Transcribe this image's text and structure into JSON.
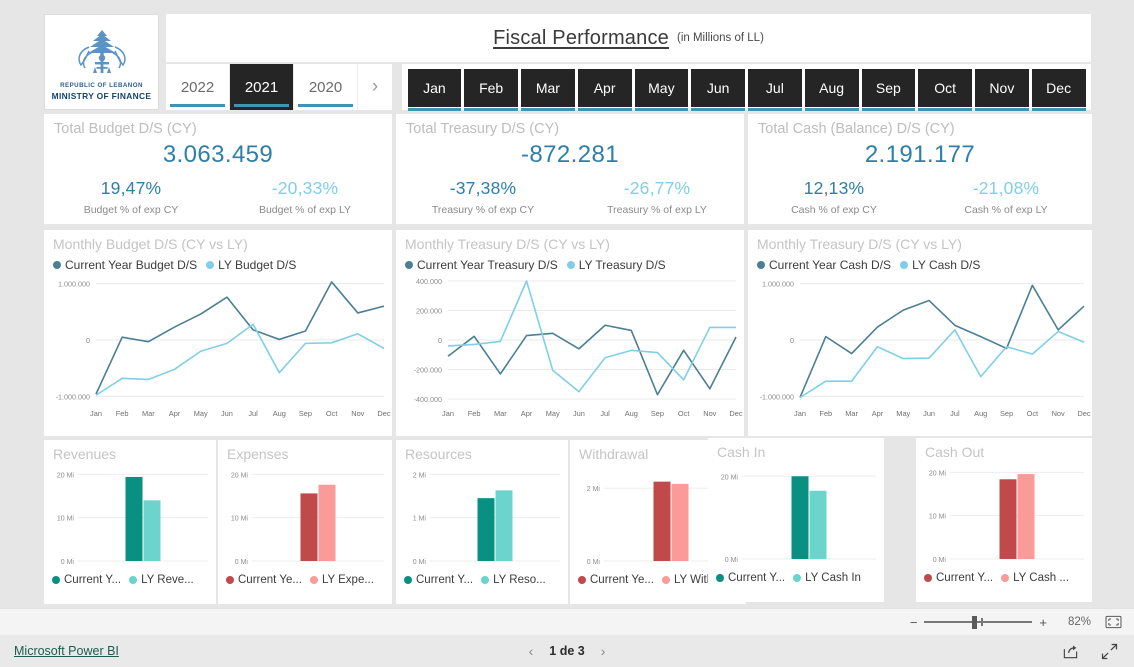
{
  "logo": {
    "icon": "lebanon-cedar-emblem-icon",
    "line1": "REPUBLIC OF LEBANON",
    "line2": "MINISTRY OF FINANCE"
  },
  "header": {
    "title": "Fiscal Performance",
    "subtitle": "(in Millions of LL)"
  },
  "year_slicer": {
    "items": [
      {
        "label": "2022",
        "selected": false
      },
      {
        "label": "2021",
        "selected": true
      },
      {
        "label": "2020",
        "selected": false
      }
    ],
    "next_icon": "chevron-right-icon"
  },
  "month_slicer": {
    "items": [
      "Jan",
      "Feb",
      "Mar",
      "Apr",
      "May",
      "Jun",
      "Jul",
      "Aug",
      "Sep",
      "Oct",
      "Nov",
      "Dec"
    ]
  },
  "kpis": [
    {
      "title": "Total Budget D/S (CY)",
      "value": "3.063.459",
      "cy_pct": "19,47%",
      "cy_label": "Budget % of exp CY",
      "ly_pct": "-20,33%",
      "ly_label": "Budget % of exp LY"
    },
    {
      "title": "Total Treasury D/S (CY)",
      "value": "-872.281",
      "cy_pct": "-37,38%",
      "cy_label": "Treasury % of exp CY",
      "ly_pct": "-26,77%",
      "ly_label": "Treasury % of exp LY"
    },
    {
      "title": "Total Cash (Balance) D/S (CY)",
      "value": "2.191.177",
      "cy_pct": "12,13%",
      "cy_label": "Cash % of exp CY",
      "ly_pct": "-21,08%",
      "ly_label": "Cash % of exp LY"
    }
  ],
  "colors": {
    "cy_line": "#4a7f94",
    "ly_line": "#7fcfe8",
    "cy_bar_teal": "#0a8f83",
    "ly_bar_teal": "#6bd4cc",
    "cy_bar_red": "#c0494a",
    "ly_bar_red": "#fa9a99",
    "value_blue": "#2e7fa8",
    "accent_underline": "#3f93b5",
    "selected_bg": "#252525"
  },
  "chart_data": [
    {
      "type": "line",
      "title": "Monthly Budget D/S (CY vs LY)",
      "xlabel": "",
      "ylabel": "",
      "categories": [
        "Jan",
        "Feb",
        "Mar",
        "Apr",
        "May",
        "Jun",
        "Jul",
        "Aug",
        "Sep",
        "Oct",
        "Nov",
        "Dec"
      ],
      "yticks": [
        -1000000,
        0,
        1000000
      ],
      "ytick_labels": [
        "-1.000.000",
        "0",
        "1.000.000"
      ],
      "ylim": [
        -1100000,
        1100000
      ],
      "grid": true,
      "legend_position": "top-left",
      "series": [
        {
          "name": "Current Year Budget D/S",
          "color": "#4a7f94",
          "values": [
            -960000,
            50000,
            -30000,
            230000,
            460000,
            760000,
            180000,
            10000,
            160000,
            1030000,
            480000,
            600000
          ]
        },
        {
          "name": "LY Budget D/S",
          "color": "#7fcfe8",
          "values": [
            -980000,
            -680000,
            -700000,
            -520000,
            -200000,
            -60000,
            280000,
            -580000,
            -60000,
            -50000,
            110000,
            -150000
          ]
        }
      ]
    },
    {
      "type": "line",
      "title": "Monthly Treasury D/S (CY vs LY)",
      "xlabel": "",
      "ylabel": "",
      "categories": [
        "Jan",
        "Feb",
        "Mar",
        "Apr",
        "May",
        "Jun",
        "Jul",
        "Aug",
        "Sep",
        "Oct",
        "Nov",
        "Dec"
      ],
      "yticks": [
        -400000,
        -200000,
        0,
        200000,
        400000
      ],
      "ytick_labels": [
        "-400.000",
        "-200.000",
        "0",
        "200.000",
        "400.000"
      ],
      "ylim": [
        -420000,
        420000
      ],
      "grid": true,
      "legend_position": "top-left",
      "series": [
        {
          "name": "Current Year Treasury D/S",
          "color": "#4a7f94",
          "values": [
            -110000,
            25000,
            -230000,
            30000,
            45000,
            -60000,
            100000,
            65000,
            -370000,
            -70000,
            -330000,
            20000
          ]
        },
        {
          "name": "LY Treasury D/S",
          "color": "#7fcfe8",
          "values": [
            -40000,
            -30000,
            -10000,
            400000,
            -205000,
            -350000,
            -120000,
            -70000,
            -85000,
            -270000,
            85000,
            85000
          ]
        }
      ]
    },
    {
      "type": "line",
      "title": "Monthly Treasury D/S (CY vs LY)",
      "xlabel": "",
      "ylabel": "",
      "categories": [
        "Jan",
        "Feb",
        "Mar",
        "Apr",
        "May",
        "Jun",
        "Jul",
        "Aug",
        "Sep",
        "Oct",
        "Nov",
        "Dec"
      ],
      "yticks": [
        -1000000,
        0,
        1000000
      ],
      "ytick_labels": [
        "-1.000.000",
        "0",
        "1.000.000"
      ],
      "ylim": [
        -1100000,
        1100000
      ],
      "grid": true,
      "legend_position": "top-left",
      "series": [
        {
          "name": "Current Year Cash D/S",
          "color": "#4a7f94",
          "values": [
            -1020000,
            60000,
            -240000,
            230000,
            530000,
            700000,
            260000,
            60000,
            -150000,
            970000,
            180000,
            600000
          ]
        },
        {
          "name": "LY Cash D/S",
          "color": "#7fcfe8",
          "values": [
            -1020000,
            -730000,
            -730000,
            -120000,
            -330000,
            -320000,
            180000,
            -650000,
            -120000,
            -250000,
            150000,
            -40000
          ]
        }
      ]
    },
    {
      "type": "bar",
      "title": "Revenues",
      "categories": [
        "Current Year Revenues",
        "LY Revenues"
      ],
      "legend": [
        "Current Y...",
        "LY Reve..."
      ],
      "values": [
        19.4,
        14.0
      ],
      "colors": [
        "#0a8f83",
        "#6bd4cc"
      ],
      "yticks": [
        0,
        10,
        20
      ],
      "ytick_labels": [
        "0 Mi",
        "10 Mi",
        "20 Mi"
      ],
      "ylim": [
        0,
        21
      ]
    },
    {
      "type": "bar",
      "title": "Expenses",
      "categories": [
        "Current Year Expenses",
        "LY Expenses"
      ],
      "legend": [
        "Current Ye...",
        "LY Expe..."
      ],
      "values": [
        15.6,
        17.6
      ],
      "colors": [
        "#c0494a",
        "#fa9a99"
      ],
      "yticks": [
        0,
        10,
        20
      ],
      "ytick_labels": [
        "0 Mi",
        "10 Mi",
        "20 Mi"
      ],
      "ylim": [
        0,
        21
      ]
    },
    {
      "type": "bar",
      "title": "Resources",
      "categories": [
        "Current Year Resources",
        "LY Resources"
      ],
      "legend": [
        "Current Y...",
        "LY Reso..."
      ],
      "values": [
        1.45,
        1.63
      ],
      "colors": [
        "#0a8f83",
        "#6bd4cc"
      ],
      "yticks": [
        0,
        1,
        2
      ],
      "ytick_labels": [
        "0 Mi",
        "1 Mi",
        "2 Mi"
      ],
      "ylim": [
        0,
        2.1
      ]
    },
    {
      "type": "bar",
      "title": "Withdrawal",
      "categories": [
        "Current Year Withdrawal",
        "LY Withdrawal"
      ],
      "legend": [
        "Current Ye...",
        "LY With..."
      ],
      "values": [
        2.18,
        2.12
      ],
      "colors": [
        "#c0494a",
        "#fa9a99"
      ],
      "yticks": [
        0,
        2
      ],
      "ytick_labels": [
        "0 Mi",
        "2 Mi"
      ],
      "ylim": [
        0,
        2.5
      ]
    },
    {
      "type": "bar",
      "title": "Cash In",
      "categories": [
        "Current Year Cash In",
        "LY Cash In"
      ],
      "legend": [
        "Current Y...",
        "LY Cash In"
      ],
      "values": [
        20.0,
        16.5
      ],
      "colors": [
        "#0a8f83",
        "#6bd4cc"
      ],
      "yticks": [
        0,
        20
      ],
      "ytick_labels": [
        "0 Mi",
        "20 Mi"
      ],
      "ylim": [
        0,
        22
      ]
    },
    {
      "type": "bar",
      "title": "Cash Out",
      "categories": [
        "Current Year Cash Out",
        "LY Cash Out"
      ],
      "legend": [
        "Current Y...",
        "LY Cash ..."
      ],
      "values": [
        18.4,
        19.6
      ],
      "colors": [
        "#c0494a",
        "#fa9a99"
      ],
      "yticks": [
        0,
        10,
        20
      ],
      "ytick_labels": [
        "0 Mi",
        "10 Mi",
        "20 Mi"
      ],
      "ylim": [
        0,
        21
      ]
    }
  ],
  "statusbar": {
    "zoom_out_icon": "minus-icon",
    "zoom_in_icon": "plus-icon",
    "zoom_level": "82%",
    "fit_icon": "fit-to-page-icon"
  },
  "footer": {
    "brand": "Microsoft Power BI",
    "prev_icon": "chevron-left-icon",
    "page_label": "1 de 3",
    "next_icon": "chevron-right-icon",
    "share_icon": "share-icon",
    "fullscreen_icon": "fullscreen-icon"
  }
}
